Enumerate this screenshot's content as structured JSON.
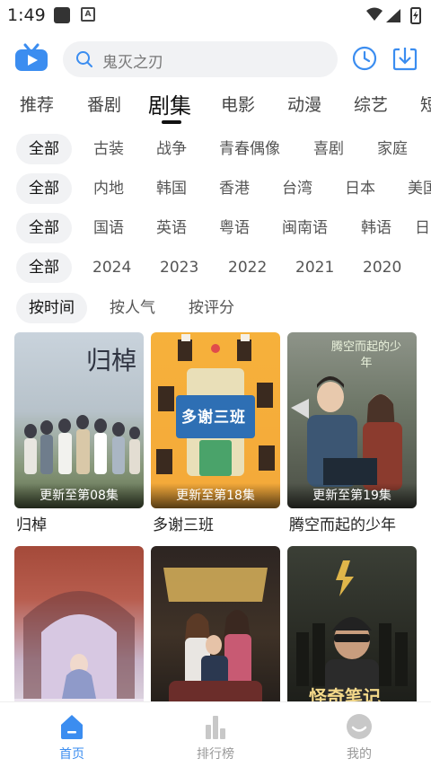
{
  "status_bar": {
    "time": "1:49"
  },
  "search": {
    "placeholder": "鬼灭之刃"
  },
  "tabs": [
    "推荐",
    "番剧",
    "剧集",
    "电影",
    "动漫",
    "综艺",
    "短"
  ],
  "active_tab": "剧集",
  "filters": {
    "genre": [
      "全部",
      "古装",
      "战争",
      "青春偶像",
      "喜剧",
      "家庭"
    ],
    "region": [
      "全部",
      "内地",
      "韩国",
      "香港",
      "台湾",
      "日本",
      "美国"
    ],
    "language": [
      "全部",
      "国语",
      "英语",
      "粤语",
      "闽南语",
      "韩语",
      "日"
    ],
    "year": [
      "全部",
      "2024",
      "2023",
      "2022",
      "2021",
      "2020"
    ],
    "sort": [
      "按时间",
      "按人气",
      "按评分"
    ]
  },
  "shows": [
    {
      "title": "归棹",
      "episode": "更新至第08集",
      "poster_text": "归棹"
    },
    {
      "title": "多谢三班",
      "episode": "更新至第18集",
      "poster_text": "多谢三班"
    },
    {
      "title": "腾空而起的少年",
      "episode": "更新至第19集",
      "poster_text": "腾空而起的少年"
    },
    {
      "title": "",
      "episode": "",
      "poster_text": ""
    },
    {
      "title": "",
      "episode": "",
      "poster_text": ""
    },
    {
      "title": "",
      "episode": "",
      "poster_text": "怪奇笔记"
    }
  ],
  "bottom_nav": [
    {
      "label": "首页",
      "icon": "home-icon"
    },
    {
      "label": "排行榜",
      "icon": "ranking-icon"
    },
    {
      "label": "我的",
      "icon": "profile-icon"
    }
  ],
  "colors": {
    "accent": "#3b8df0",
    "chip_bg": "#f1f2f4"
  }
}
